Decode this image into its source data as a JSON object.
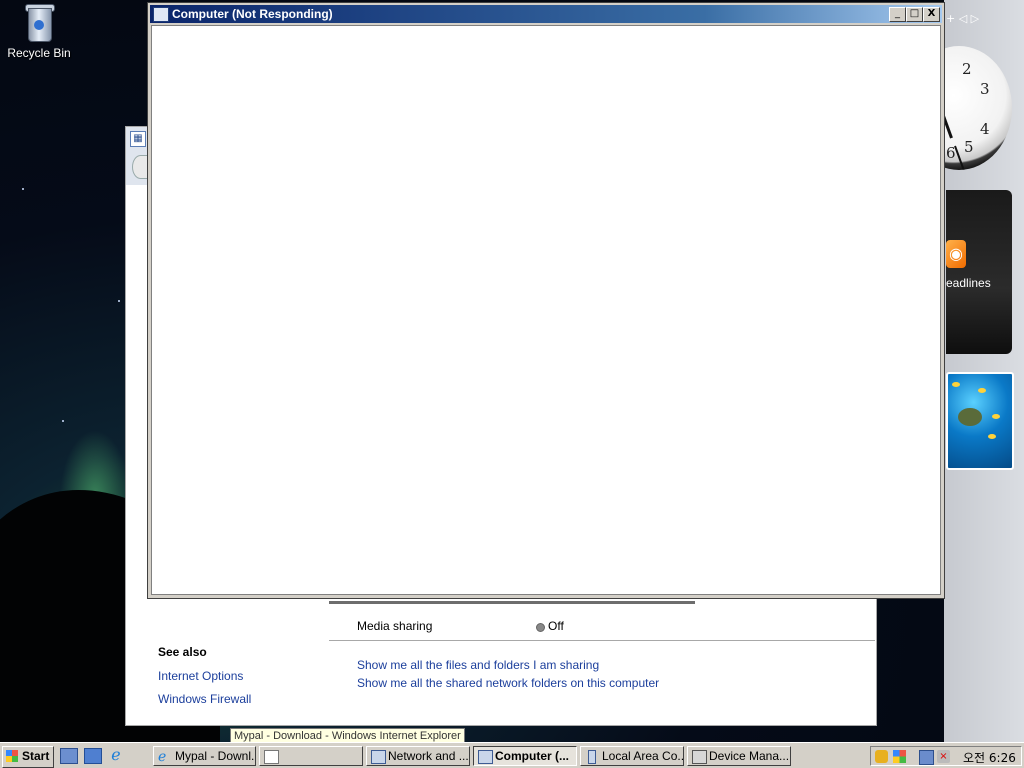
{
  "desktop": {
    "recycle_bin_label": "Recycle Bin"
  },
  "gadgets": {
    "clock_numbers": [
      "2",
      "3",
      "4",
      "5",
      "6"
    ],
    "feed_label": "eadlines"
  },
  "main_window": {
    "title": "Computer (Not Responding)",
    "buttons": {
      "minimize": "_",
      "maximize": "□",
      "close": "X"
    }
  },
  "network_window": {
    "media_sharing_label": "Media sharing",
    "media_sharing_value": "Off",
    "see_also_heading": "See also",
    "see_also_links": [
      "Internet Options",
      "Windows Firewall"
    ],
    "show_links": [
      "Show me all the files and folders I am sharing",
      "Show me all the shared network folders on this computer"
    ]
  },
  "tooltip": "Mypal - Download - Windows Internet Explorer",
  "taskbar": {
    "start_label": "Start",
    "tasks": [
      {
        "label": "Mypal - Downl..."
      },
      {
        "label": ""
      },
      {
        "label": "Network and ..."
      },
      {
        "label": "Computer (..."
      },
      {
        "label": "Local Area Co..."
      },
      {
        "label": "Device Mana..."
      }
    ],
    "clock": "오전 6:26"
  },
  "sidebar": {
    "controls": "+  ◁ ▷"
  }
}
